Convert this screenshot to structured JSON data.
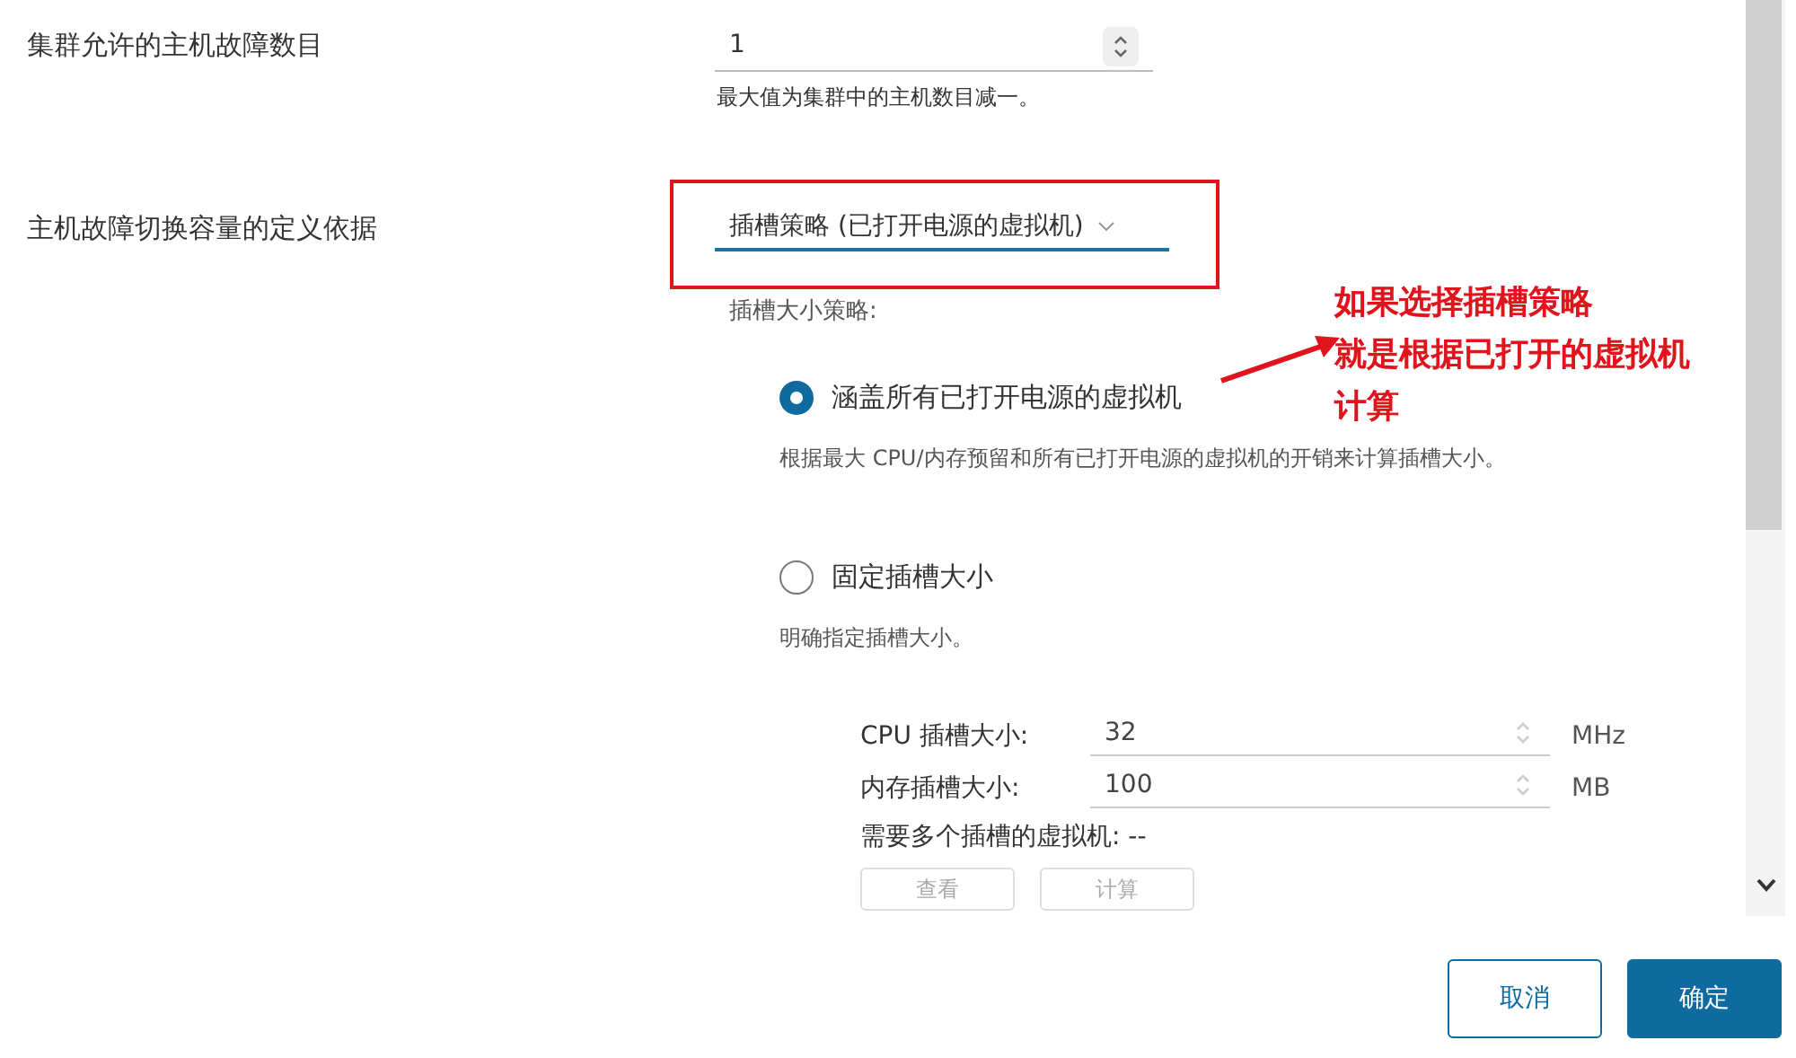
{
  "fields": [
    {
      "kind": "number",
      "label": "集群允许的主机故障数目",
      "value": "1",
      "hint": "最大值为集群中的主机数目减一。"
    },
    {
      "kind": "select",
      "label": "主机故障切换容量的定义依据",
      "value": "插槽策略 (已打开电源的虚拟机)",
      "hint": "插槽大小策略:"
    }
  ],
  "slot_options": [
    {
      "label": "涵盖所有已打开电源的虚拟机",
      "selected": true,
      "description": "根据最大 CPU/内存预留和所有已打开电源的虚拟机的开销来计算插槽大小。"
    },
    {
      "label": "固定插槽大小",
      "selected": false,
      "description": "明确指定插槽大小。"
    }
  ],
  "slot_sizes": [
    {
      "label": "CPU 插槽大小:",
      "value": "32",
      "unit": "MHz"
    },
    {
      "label": "内存插槽大小:",
      "value": "100",
      "unit": "MB"
    }
  ],
  "multi_slot_vms": "需要多个插槽的虚拟机: --",
  "slot_buttons": [
    "查看",
    "计算"
  ],
  "annotation": {
    "lines": [
      "如果选择插槽策略",
      "就是根据已打开的虚拟机",
      "计算"
    ]
  },
  "footer_buttons": [
    {
      "label": "取消",
      "kind": "secondary"
    },
    {
      "label": "确定",
      "kind": "primary"
    }
  ]
}
